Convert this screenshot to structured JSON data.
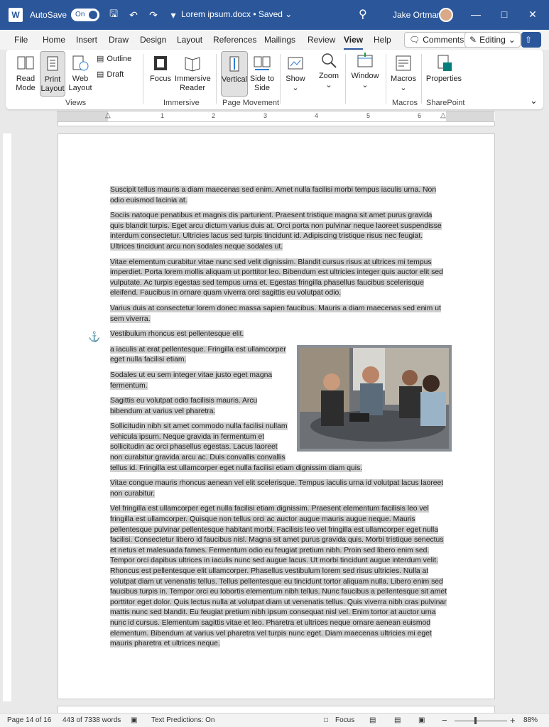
{
  "titlebar": {
    "app_letter": "W",
    "autosave_label": "AutoSave",
    "autosave_state": "On",
    "doc_title": "Lorem ipsum.docx • Saved",
    "user_name": "Jake Ortman",
    "accent": "#2b579a"
  },
  "tabs": [
    "File",
    "Home",
    "Insert",
    "Draw",
    "Design",
    "Layout",
    "References",
    "Mailings",
    "Review",
    "View",
    "Help"
  ],
  "active_tab": "View",
  "tabbar": {
    "comments": "Comments",
    "editing": "Editing"
  },
  "ribbon": {
    "views": {
      "read_mode": "Read Mode",
      "print_layout": "Print Layout",
      "web_layout": "Web Layout",
      "outline": "Outline",
      "draft": "Draft",
      "label": "Views"
    },
    "immersive": {
      "focus": "Focus",
      "immersive_reader": "Immersive Reader",
      "label": "Immersive"
    },
    "page_movement": {
      "vertical": "Vertical",
      "side_to_side": "Side to Side",
      "label": "Page Movement"
    },
    "show": "Show",
    "zoom": "Zoom",
    "window": "Window",
    "macros": {
      "button": "Macros",
      "label": "Macros"
    },
    "sharepoint": {
      "properties": "Properties",
      "label": "SharePoint"
    }
  },
  "ruler": [
    "1",
    "2",
    "3",
    "4",
    "5",
    "6"
  ],
  "document": {
    "p1": "Suscipit tellus mauris a diam maecenas sed enim. Amet nulla facilisi morbi tempus iaculis urna. Non odio euismod lacinia at.",
    "p2": "Sociis natoque penatibus et magnis dis parturient. Praesent tristique magna sit amet purus gravida quis blandit turpis. Eget arcu dictum varius duis at. Orci porta non pulvinar neque laoreet suspendisse interdum consectetur. Ultricies lacus sed turpis tincidunt id. Adipiscing tristique risus nec feugiat. Ultrices tincidunt arcu non sodales neque sodales ut.",
    "p3": "Vitae elementum curabitur vitae nunc sed velit dignissim. Blandit cursus risus at ultrices mi tempus imperdiet. Porta lorem mollis aliquam ut porttitor leo. Bibendum est ultricies integer quis auctor elit sed vulputate. Ac turpis egestas sed tempus urna et. Egestas fringilla phasellus faucibus scelerisque eleifend. Faucibus in ornare quam viverra orci sagittis eu volutpat odio.",
    "p4": "Varius duis at consectetur lorem donec massa sapien faucibus. Mauris a diam maecenas sed enim ut sem viverra.",
    "p5": "Vestibulum rhoncus est pellentesque elit.",
    "p6": "a iaculis at erat pellentesque. Fringilla est ullamcorper eget nulla facilisi etiam.",
    "p7": "Sodales ut eu sem integer vitae justo eget magna fermentum.",
    "p8": "Sagittis eu volutpat odio facilisis mauris. Arcu bibendum at varius vel pharetra.",
    "p9": "Sollicitudin nibh sit amet commodo nulla facilisi nullam vehicula ipsum. Neque gravida in fermentum et sollicitudin ac orci phasellus egestas. Lacus laoreet non curabitur gravida arcu ac. Duis convallis convallis tellus id. Fringilla est ullamcorper eget nulla facilisi etiam dignissim diam quis.",
    "p10": "Vitae congue mauris rhoncus aenean vel elit scelerisque. Tempus iaculis urna id volutpat lacus laoreet non curabitur.",
    "p11": "Vel fringilla est ullamcorper eget nulla facilisi etiam dignissim. Praesent elementum facilisis leo vel fringilla est ullamcorper. Quisque non tellus orci ac auctor augue mauris augue neque. Mauris pellentesque pulvinar pellentesque habitant morbi. Facilisis leo vel fringilla est ullamcorper eget nulla facilisi. Consectetur libero id faucibus nisl. Magna sit amet purus gravida quis. Morbi tristique senectus et netus et malesuada fames. Fermentum odio eu feugiat pretium nibh. Proin sed libero enim sed. Tempor orci dapibus ultrices in iaculis nunc sed augue lacus. Ut morbi tincidunt augue interdum velit. Rhoncus est pellentesque elit ullamcorper. Phasellus vestibulum lorem sed risus ultricies. Nulla at volutpat diam ut venenatis tellus. Tellus pellentesque eu tincidunt tortor aliquam nulla. Libero enim sed faucibus turpis in. Tempor orci eu lobortis elementum nibh tellus. Nunc faucibus a pellentesque sit amet porttitor eget dolor. Quis lectus nulla at volutpat diam ut venenatis tellus. Quis viverra nibh cras pulvinar mattis nunc sed blandit. Eu feugiat pretium nibh ipsum consequat nisl vel. Enim tortor at auctor urna nunc id cursus. Elementum sagittis vitae et leo. Pharetra et ultrices neque ornare aenean euismod elementum. Bibendum at varius vel pharetra vel turpis nunc eget. Diam maecenas ultricies mi eget mauris pharetra et ultrices neque."
  },
  "statusbar": {
    "page": "Page 14 of 16",
    "words": "443 of 7338 words",
    "predictions": "Text Predictions: On",
    "focus": "Focus",
    "zoom": "88%"
  }
}
